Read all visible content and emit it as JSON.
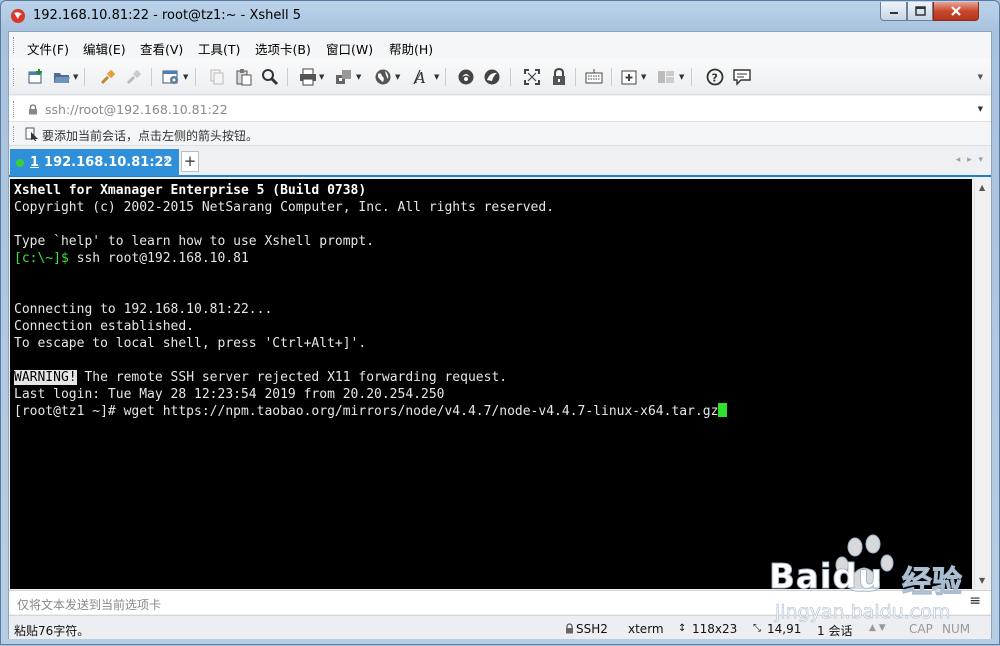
{
  "window": {
    "title": "192.168.10.81:22 - root@tz1:~ - Xshell 5"
  },
  "menu": [
    {
      "label": "文件(F)"
    },
    {
      "label": "编辑(E)"
    },
    {
      "label": "查看(V)"
    },
    {
      "label": "工具(T)"
    },
    {
      "label": "选项卡(B)"
    },
    {
      "label": "窗口(W)"
    },
    {
      "label": "帮助(H)"
    }
  ],
  "toolbar": {
    "icons": [
      "new-session-icon",
      "open-folder-icon",
      "connect-icon",
      "disconnect-icon",
      "properties-icon",
      "copy-icon",
      "paste-icon",
      "find-icon",
      "print-icon",
      "transfer-icon",
      "globe-icon",
      "font-icon",
      "xftp-icon",
      "xmanager-icon",
      "fullscreen-icon",
      "lock-icon",
      "keyboard-icon",
      "new-tab-icon",
      "layout-icon",
      "help-icon",
      "chat-icon"
    ]
  },
  "address": {
    "value": "ssh://root@192.168.10.81:22"
  },
  "hint": {
    "text": "要添加当前会话，点击左侧的箭头按钮。"
  },
  "tabs": {
    "active": {
      "number": "1",
      "label": "192.168.10.81:22"
    },
    "add_label": "+"
  },
  "terminal": {
    "lines": {
      "l1": "Xshell for Xmanager Enterprise 5 (Build 0738)",
      "l2": "Copyright (c) 2002-2015 NetSarang Computer, Inc. All rights reserved.",
      "l3": "Type `help' to learn how to use Xshell prompt.",
      "l4_prompt": "[c:\\~]$",
      "l4_cmd": " ssh root@192.168.10.81",
      "l5": "Connecting to 192.168.10.81:22...",
      "l6": "Connection established.",
      "l7": "To escape to local shell, press 'Ctrl+Alt+]'.",
      "l8_warn": "WARNING!",
      "l8_rest": " The remote SSH server rejected X11 forwarding request.",
      "l9": "Last login: Tue May 28 12:23:54 2019 from 20.20.254.250",
      "l10": "[root@tz1 ~]# wget https://npm.taobao.org/mirrors/node/v4.4.7/node-v4.4.7-linux-x64.tar.gz"
    }
  },
  "compose": {
    "placeholder": "仅将文本发送到当前选项卡"
  },
  "status": {
    "message": "粘贴76字符。",
    "protocol": "SSH2",
    "terminal_type": "xterm",
    "size": "118x23",
    "position": "14,91",
    "sessions": "1 会话",
    "cap": "CAP",
    "num": "NUM"
  },
  "watermark": {
    "brand": "Baidu",
    "cn": "经验",
    "url": "jingyan.baidu.com"
  },
  "colors": {
    "tab_active": "#2f8fd8",
    "terminal_bg": "#000000",
    "prompt_green": "#3ee03e",
    "cursor": "#2fe02f"
  }
}
